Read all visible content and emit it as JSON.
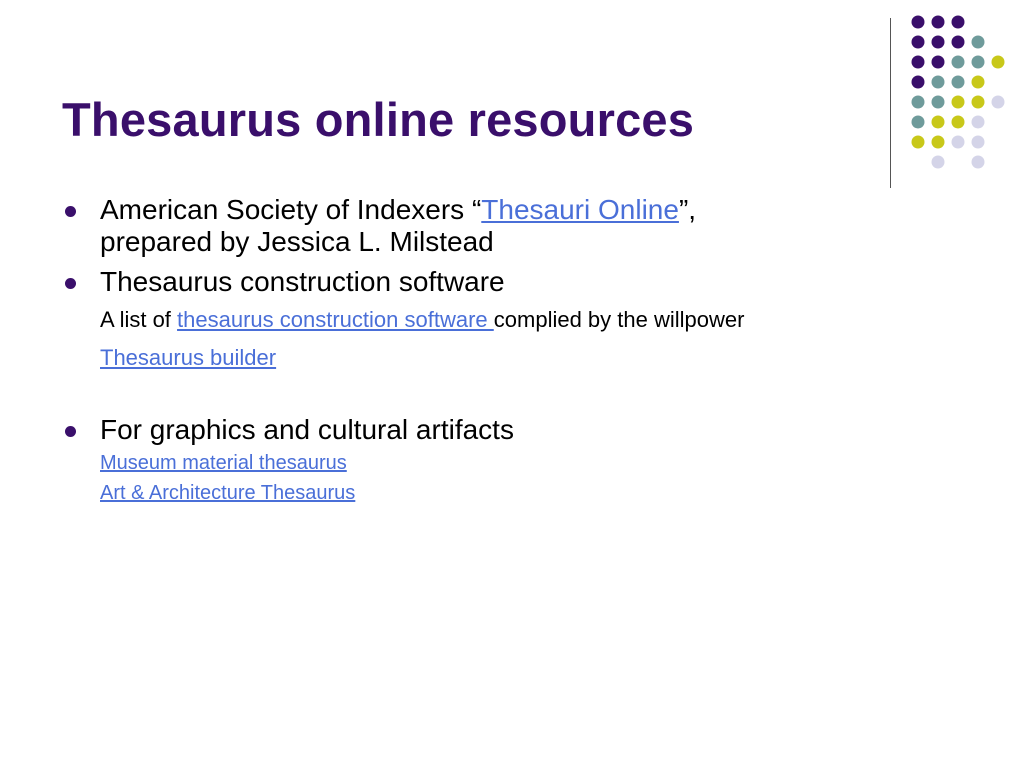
{
  "slide": {
    "title": "Thesaurus online resources",
    "colors": {
      "title": "#3a0f6b",
      "link": "#4a6fd8",
      "dot_purple": "#3a0f6b",
      "dot_teal": "#6f9b9b",
      "dot_yellow": "#c8c81a",
      "dot_lavender": "#d4d4e8"
    },
    "decoration_icon": "dot-grid-ornament",
    "bullets": {
      "b1": {
        "prefix": "American Society of Indexers “",
        "link": "Thesauri Online",
        "suffix": "”,",
        "line2": "prepared by Jessica L. Milstead"
      },
      "b2": {
        "text": "Thesaurus construction software",
        "sub1_prefix": "A list of ",
        "sub1_link": "thesaurus construction software ",
        "sub1_suffix": "complied by the willpower",
        "sub2_link": "Thesaurus builder"
      },
      "b3": {
        "text": "For graphics and cultural artifacts",
        "sub1_link": "Museum material thesaurus",
        "sub2_link": "Art & Architecture Thesaurus"
      }
    }
  }
}
